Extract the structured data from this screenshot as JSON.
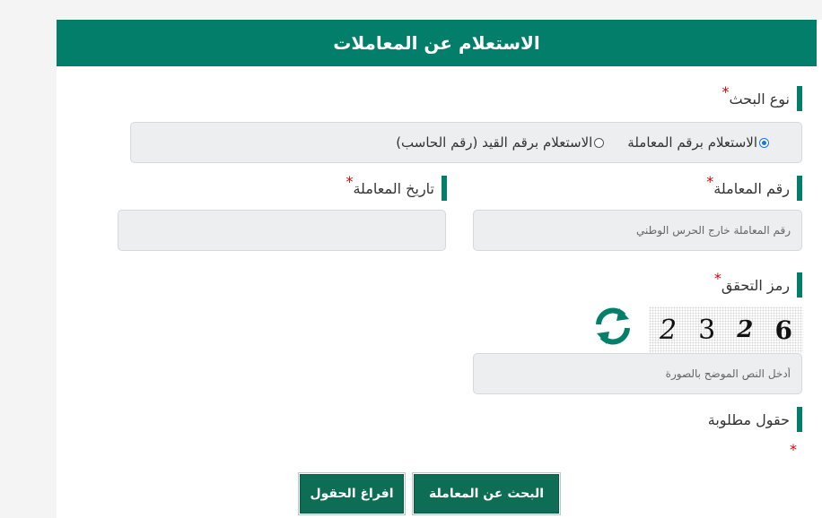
{
  "header": {
    "title": "الاستعلام عن المعاملات"
  },
  "search_type": {
    "label": "نوع البحث",
    "required_mark": "*",
    "options": [
      {
        "label": "الاستعلام برقم المعاملة",
        "checked": true
      },
      {
        "label": "الاستعلام برقم القيد (رقم الحاسب)",
        "checked": false
      }
    ]
  },
  "transaction_number": {
    "label": "رقم المعاملة",
    "required_mark": "*",
    "placeholder": "رقم المعاملة خارج الحرس الوطني",
    "value": ""
  },
  "transaction_date": {
    "label": "تاريخ المعاملة",
    "required_mark": "*",
    "value": ""
  },
  "captcha": {
    "label": "رمز التحقق",
    "required_mark": "*",
    "digits": [
      "2",
      "3",
      "2",
      "6"
    ],
    "placeholder": "أدخل النص الموضح بالصورة",
    "refresh_icon": "refresh-icon"
  },
  "required_note": {
    "label": "حقول مطلوبة",
    "mark": "*"
  },
  "buttons": {
    "search": "البحث عن المعاملة",
    "clear": "افراغ الحقول"
  },
  "colors": {
    "brand": "#037e6b",
    "button": "#0d6e55",
    "required": "#d60000"
  }
}
